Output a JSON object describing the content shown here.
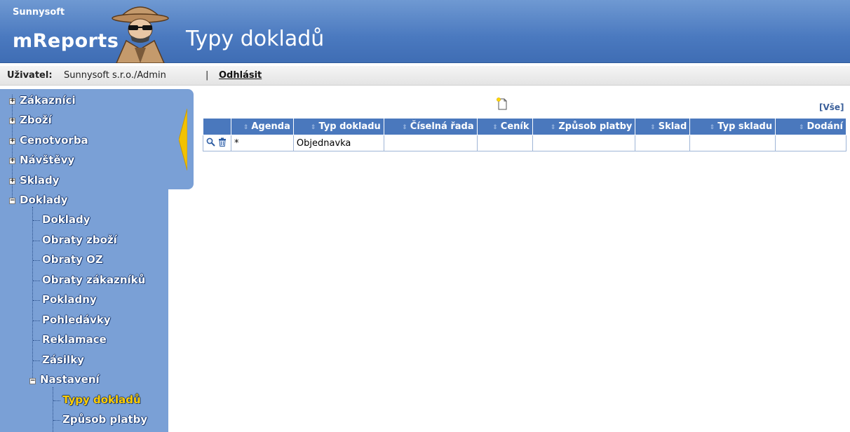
{
  "header": {
    "brand_small": "Sunnysoft",
    "brand_big": "mReports",
    "page_title": "Typy dokladů"
  },
  "userbar": {
    "user_label": "Uživatel:",
    "user_name": "Sunnysoft s.r.o./Admin",
    "separator": "|",
    "logout": "Odhlásit"
  },
  "sidebar": {
    "items": [
      {
        "label": "Zákazníci",
        "toggle": "+"
      },
      {
        "label": "Zboží",
        "toggle": "+"
      },
      {
        "label": "Cenotvorba",
        "toggle": "+"
      },
      {
        "label": "Návštěvy",
        "toggle": "+"
      },
      {
        "label": "Sklady",
        "toggle": "+"
      },
      {
        "label": "Doklady",
        "toggle": "−"
      }
    ],
    "doklady_children": [
      "Doklady",
      "Obraty zboží",
      "Obraty OZ",
      "Obraty zákazníků",
      "Pokladny",
      "Pohledávky",
      "Reklamace",
      "Zásilky"
    ],
    "nastaveni": {
      "label": "Nastavení",
      "toggle": "−"
    },
    "nastaveni_children": [
      {
        "label": "Typy dokladů",
        "active": true
      },
      {
        "label": "Způsob platby",
        "active": false
      }
    ]
  },
  "toolbar": {
    "new_icon": "new-document-icon",
    "all_link": "[Vše]"
  },
  "table": {
    "columns": [
      "Agenda",
      "Typ dokladu",
      "Číselná řada",
      "Ceník",
      "Způsob platby",
      "Sklad",
      "Typ skladu",
      "Dodání"
    ],
    "rows": [
      {
        "cells": [
          "*",
          "Objednavka",
          "",
          "",
          "",
          "",
          "",
          ""
        ],
        "actions": [
          "magnifier-icon",
          "trash-icon"
        ]
      }
    ]
  },
  "colors": {
    "header_bg": "#4a79bf",
    "sidebar_bg": "#7aa0d6",
    "table_header_bg": "#4a78bd",
    "active_nav": "#ffcc00"
  }
}
